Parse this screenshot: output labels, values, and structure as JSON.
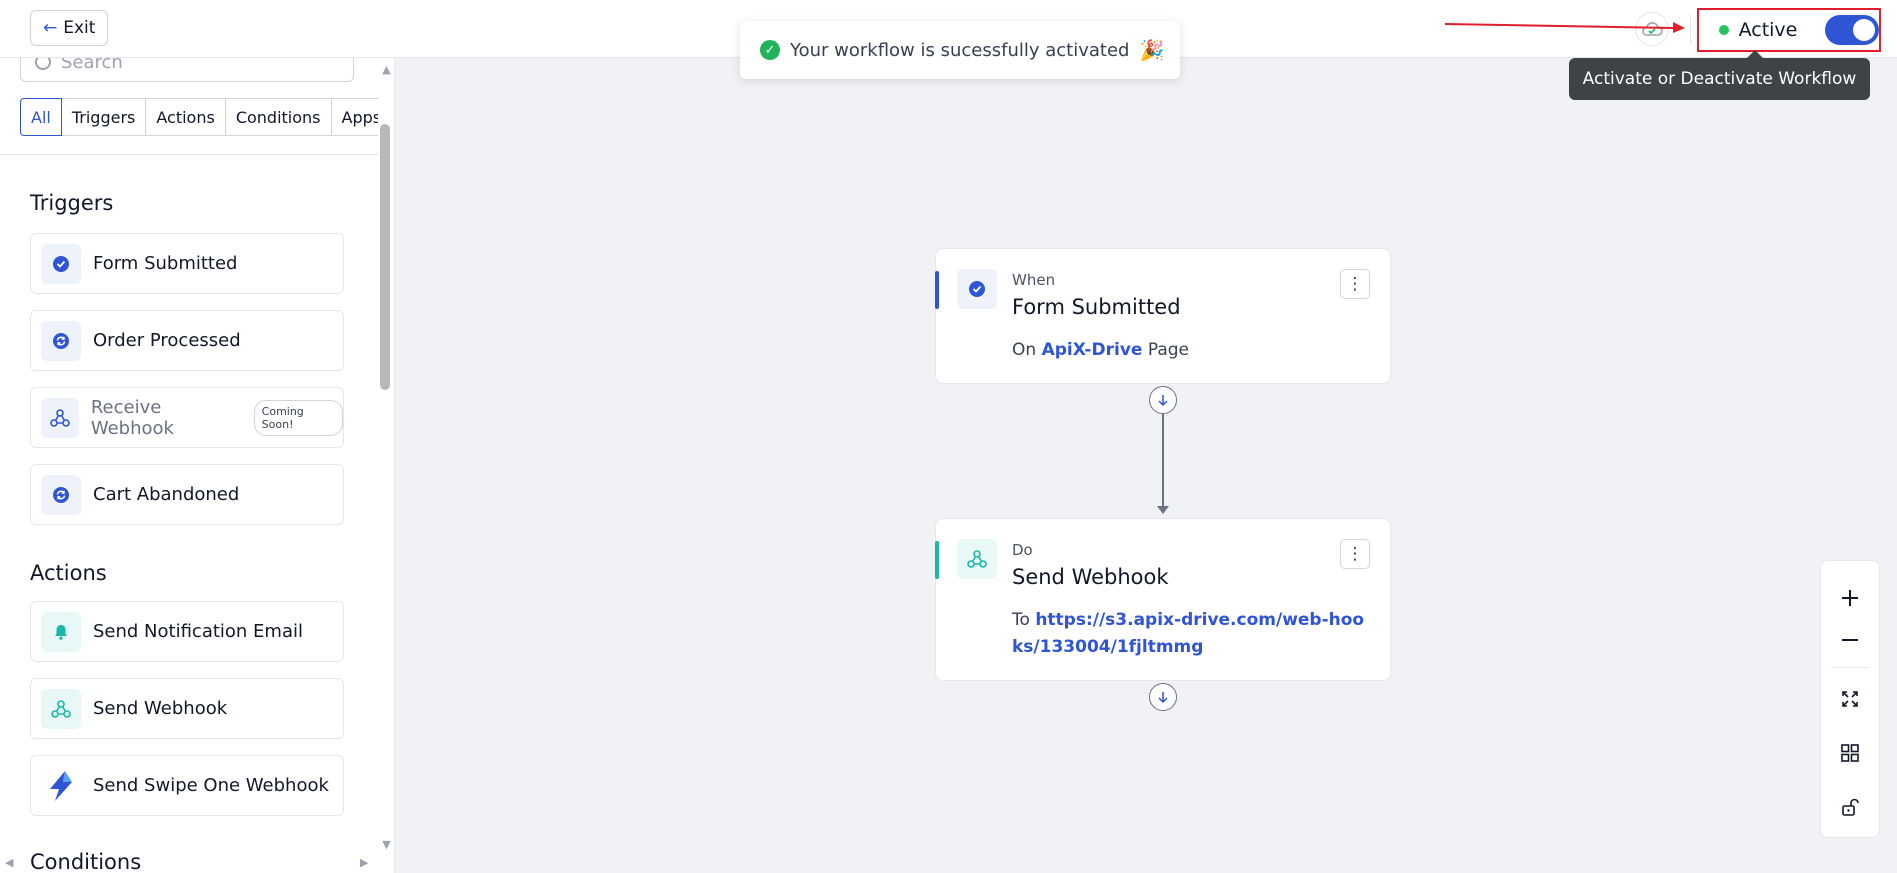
{
  "topbar": {
    "exit_label": "Exit",
    "status_label": "Active",
    "tooltip": "Activate or Deactivate Workflow",
    "toast": "Your workflow is sucessfully activated",
    "toast_emoji": "🎉"
  },
  "sidebar": {
    "search_placeholder": "Search",
    "filters": [
      "All",
      "Triggers",
      "Actions",
      "Conditions",
      "Apps"
    ],
    "active_filter": "All",
    "triggers_title": "Triggers",
    "triggers": [
      {
        "label": "Form Submitted",
        "icon": "check-circle-icon"
      },
      {
        "label": "Order Processed",
        "icon": "refresh-icon"
      },
      {
        "label": "Receive Webhook",
        "icon": "webhook-icon",
        "badge": "Coming Soon!"
      },
      {
        "label": "Cart Abandoned",
        "icon": "refresh-icon"
      }
    ],
    "actions_title": "Actions",
    "actions": [
      {
        "label": "Send Notification Email",
        "icon": "bell-icon"
      },
      {
        "label": "Send Webhook",
        "icon": "webhook-icon"
      },
      {
        "label": "Send Swipe One Webhook",
        "icon": "lightning-icon"
      }
    ],
    "cut_section_title": "Conditions"
  },
  "canvas": {
    "trigger_node": {
      "kind": "When",
      "title": "Form Submitted",
      "desc_prefix": "On",
      "desc_link": "ApiX-Drive",
      "desc_suffix": "Page"
    },
    "action_node": {
      "kind": "Do",
      "title": "Send Webhook",
      "desc_prefix": "To",
      "desc_link": "https://s3.apix-drive.com/web-hooks/133004/1fjltmmg"
    }
  },
  "colors": {
    "accent": "#2f55d4",
    "teal": "#19b8a6",
    "success": "#22b35a",
    "highlight_red": "#e11d2e"
  }
}
